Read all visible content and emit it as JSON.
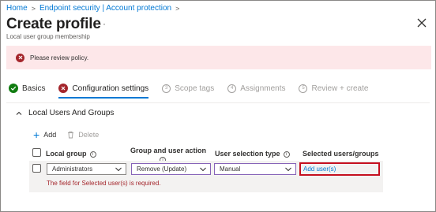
{
  "breadcrumb": {
    "home": "Home",
    "endpoint": "Endpoint security | Account protection"
  },
  "header": {
    "title": "Create profile",
    "more": "···",
    "subtitle": "Local user group membership"
  },
  "banner": {
    "message": "Please review policy."
  },
  "tabs": [
    {
      "label": "Basics",
      "state": "complete"
    },
    {
      "label": "Configuration settings",
      "state": "error"
    },
    {
      "label": "Scope tags",
      "number": "3",
      "state": "disabled"
    },
    {
      "label": "Assignments",
      "number": "4",
      "state": "disabled"
    },
    {
      "label": "Review + create",
      "number": "5",
      "state": "disabled"
    }
  ],
  "section": {
    "title": "Local Users And Groups"
  },
  "toolbar": {
    "add": "Add",
    "delete": "Delete"
  },
  "table": {
    "headers": {
      "local_group": "Local group",
      "group_user_action": "Group and user action",
      "user_selection_type": "User selection type",
      "selected": "Selected users/groups"
    },
    "row": {
      "local_group": "Administrators",
      "action": "Remove (Update)",
      "selection_type": "Manual",
      "add_users_link": "Add user(s)",
      "error": "The field for Selected user(s) is required."
    }
  },
  "colors": {
    "accent": "#0078d4",
    "error": "#a4262c",
    "success": "#107c10",
    "banner_bg": "#fde7e9"
  }
}
